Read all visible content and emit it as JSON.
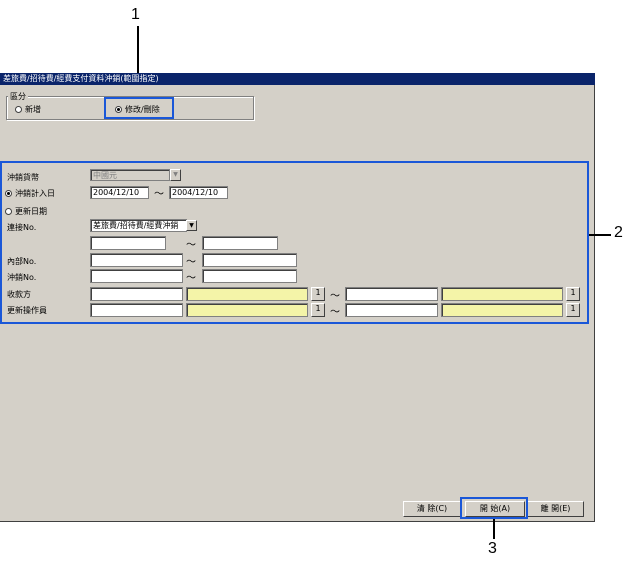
{
  "window": {
    "title": "差旅費/招待費/經費支付資料沖銷(範圍指定)"
  },
  "category": {
    "label": "區分",
    "options": [
      {
        "label": "新增",
        "selected": false
      },
      {
        "label": "修改/刪除",
        "selected": true
      }
    ]
  },
  "form": {
    "currency": {
      "label": "沖銷貨幣",
      "value": "中國元",
      "disabled": true
    },
    "date_type": [
      {
        "label": "沖銷計入日",
        "selected": true
      },
      {
        "label": "更新日期",
        "selected": false
      }
    ],
    "date_from": "2004/12/10",
    "date_to": "2004/12/10",
    "range_sep": "～",
    "link_no": {
      "label": "連接No.",
      "value": "差旅費/招待費/經費沖銷"
    },
    "internal_no": {
      "label": "內部No."
    },
    "writeoff_no": {
      "label": "沖銷No."
    },
    "payee": {
      "label": "收款方"
    },
    "update_operator": {
      "label": "更新操作員"
    },
    "lookup_button": "1"
  },
  "buttons": {
    "clear": "清 除(C)",
    "start": "開 始(A)",
    "close": "離 開(E)"
  },
  "annotations": {
    "one": "1",
    "two": "2",
    "three": "3"
  },
  "colors": {
    "callout": "#1a57d8",
    "titlebar": "#0a246a",
    "yellow_field": "#fefeb0"
  }
}
